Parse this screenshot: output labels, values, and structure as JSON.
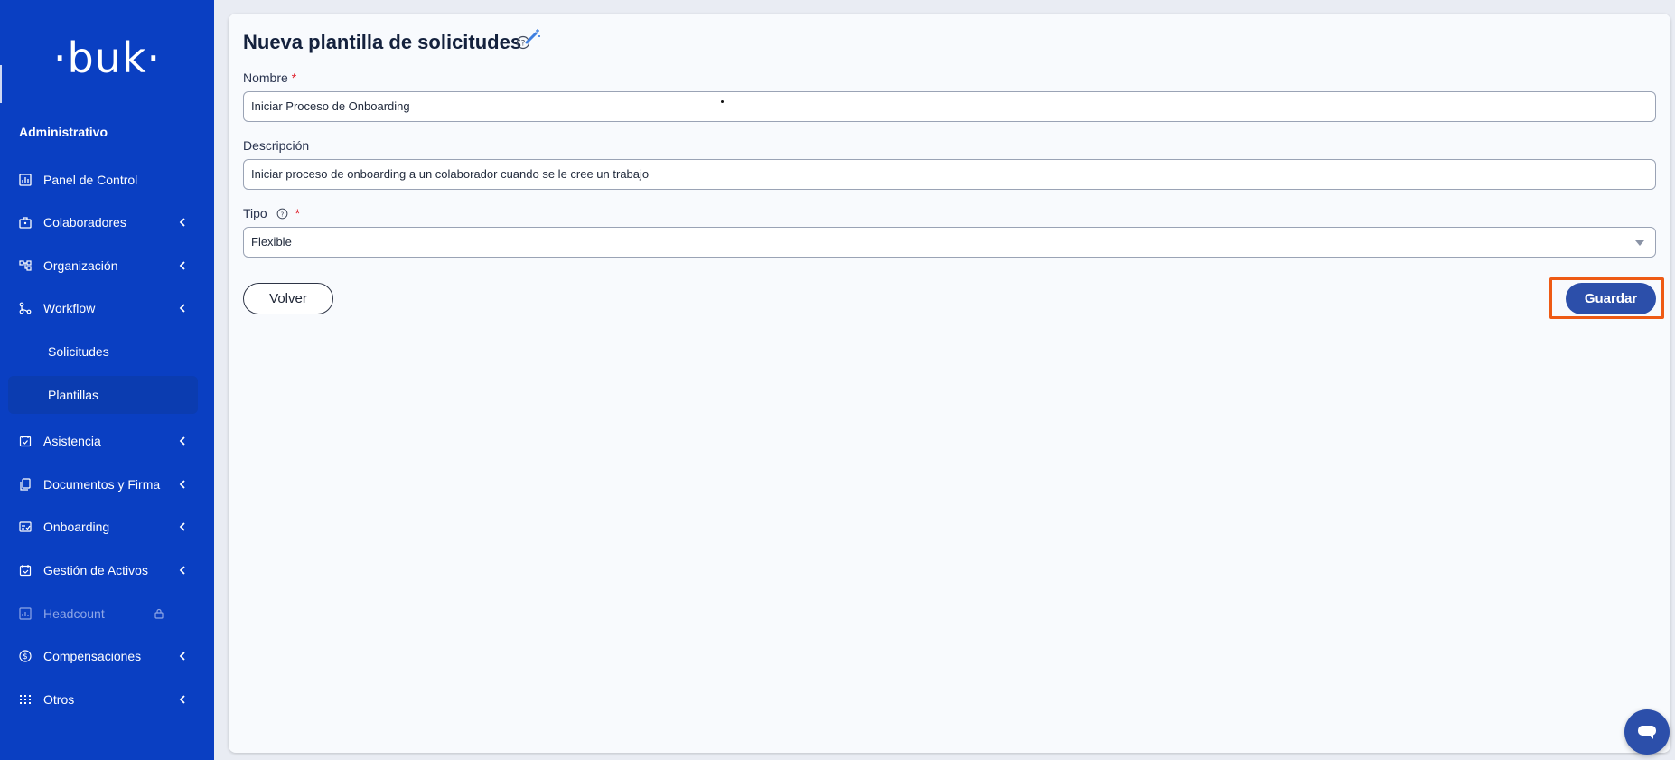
{
  "sidebar": {
    "logo": "·buk·",
    "section_title": "Administrativo",
    "items": [
      {
        "label": "Panel de Control",
        "icon": "dashboard-icon",
        "has_chevron": false
      },
      {
        "label": "Colaboradores",
        "icon": "briefcase-icon",
        "has_chevron": true
      },
      {
        "label": "Organización",
        "icon": "org-chart-icon",
        "has_chevron": true
      },
      {
        "label": "Workflow",
        "icon": "workflow-icon",
        "has_chevron": true
      },
      {
        "label": "Asistencia",
        "icon": "calendar-check-icon",
        "has_chevron": true
      },
      {
        "label": "Documentos y Firma",
        "icon": "documents-icon",
        "has_chevron": true
      },
      {
        "label": "Onboarding",
        "icon": "onboarding-icon",
        "has_chevron": true
      },
      {
        "label": "Gestión de Activos",
        "icon": "assets-icon",
        "has_chevron": true
      },
      {
        "label": "Headcount",
        "icon": "headcount-icon",
        "has_chevron": false,
        "locked": true
      },
      {
        "label": "Compensaciones",
        "icon": "dollar-circle-icon",
        "has_chevron": true
      },
      {
        "label": "Otros",
        "icon": "grid-icon",
        "has_chevron": true
      }
    ],
    "workflow_sub": [
      {
        "label": "Solicitudes",
        "active": false
      },
      {
        "label": "Plantillas",
        "active": true
      }
    ]
  },
  "main": {
    "title": "Nueva plantilla de solicitudes",
    "fields": {
      "nombre": {
        "label": "Nombre",
        "required_mark": "*",
        "value": "Iniciar Proceso de Onboarding"
      },
      "descripcion": {
        "label": "Descripción",
        "value": "Iniciar proceso de onboarding a un colaborador cuando se le cree un trabajo"
      },
      "tipo": {
        "label": "Tipo",
        "required_mark": "*",
        "value": "Flexible"
      }
    },
    "buttons": {
      "back": "Volver",
      "save": "Guardar"
    }
  },
  "colors": {
    "sidebar_bg": "#0a3fc2",
    "primary_button": "#2c4faa",
    "highlight": "#ee5a14",
    "required": "#e0232e"
  }
}
